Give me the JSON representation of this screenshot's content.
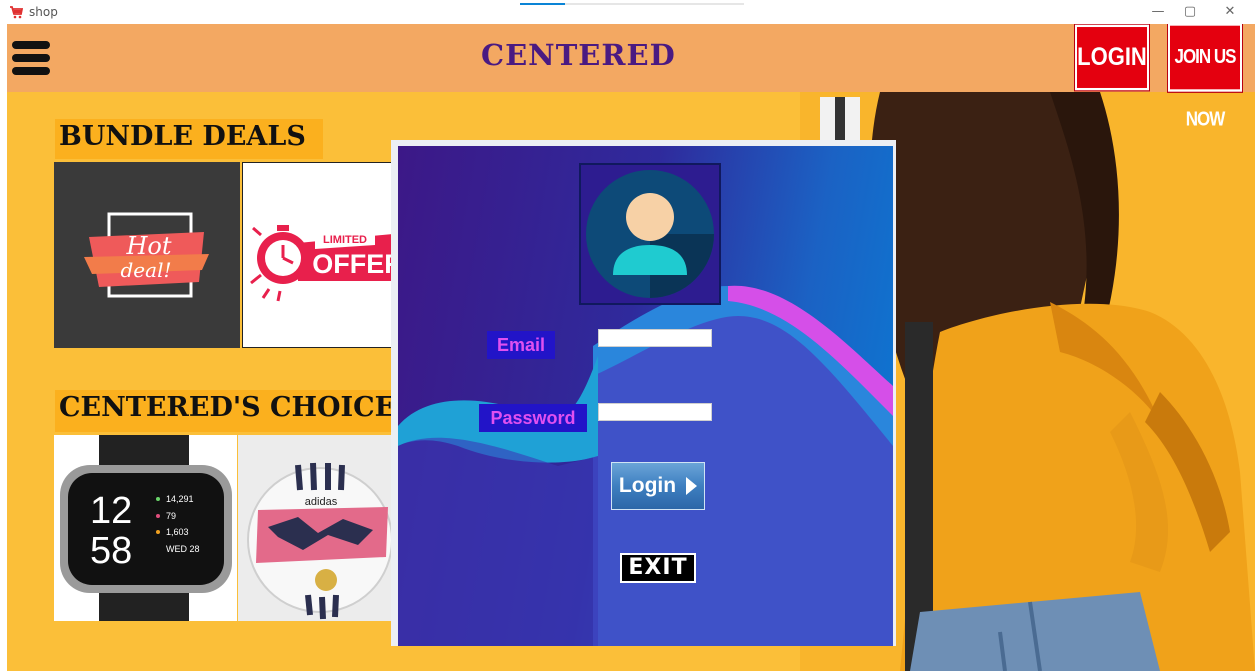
{
  "window": {
    "title": "shop",
    "icon": "cart-icon",
    "controls": {
      "minimize": "—",
      "maximize": "▢",
      "close": "✕"
    },
    "loading_progress": 0.2
  },
  "header": {
    "menu_icon": "hamburger-icon",
    "brand": "CENTERED",
    "login_label": "LOGIN",
    "join_label": "JOIN US NOW",
    "colors": {
      "bar": "#f3a862",
      "brand": "#4a1a82",
      "button": "#e4000f"
    }
  },
  "sections": {
    "bundle_title": "BUNDLE DEALS",
    "choice_title": "CENTERED'S CHOICE"
  },
  "tiles": {
    "hot_deal": {
      "line1": "Hot",
      "line2": "deal!"
    },
    "limited_offer": {
      "line1": "LIMITED",
      "line2": "OFFER"
    },
    "watch": {
      "hour": "12",
      "minute": "58",
      "steps": "14,291",
      "heart": "79",
      "calories": "1,603",
      "date": "WED 28"
    },
    "ball": {
      "brand": "adidas"
    }
  },
  "login": {
    "email_label": "Email",
    "email_value": "",
    "password_label": "Password",
    "password_value": "",
    "submit_label": "Login",
    "exit_label": "EXIT",
    "avatar_icon": "user-avatar-icon"
  },
  "colors": {
    "page_bg": "#fbbf39",
    "dialog_start": "#3c1887",
    "dialog_end": "#0a7ad4",
    "label_bg": "#2214c8",
    "label_text": "#e050f0"
  }
}
